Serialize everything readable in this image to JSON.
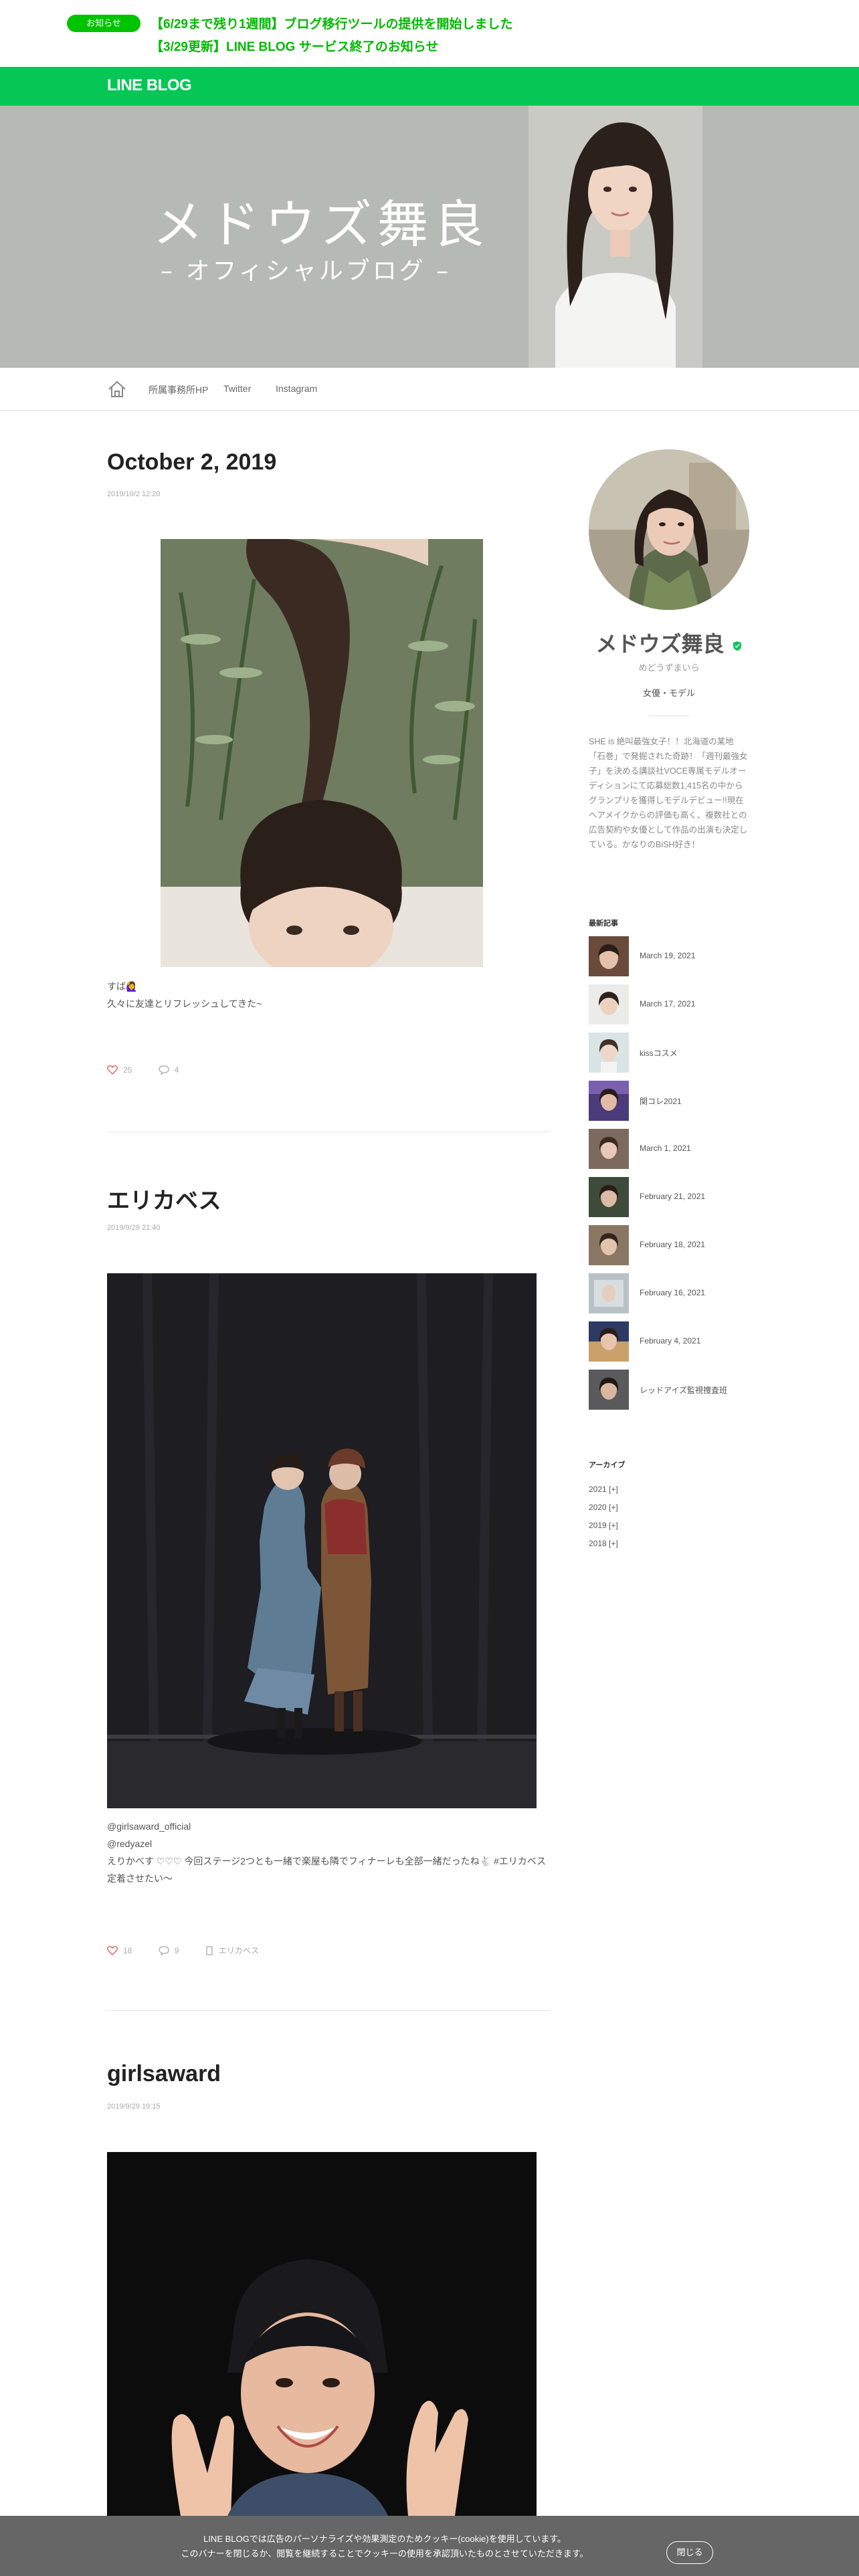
{
  "notice": {
    "badge": "お知らせ",
    "links": [
      "【6/29まで残り1週間】ブログ移行ツールの提供を開始しました",
      "【3/29更新】LINE BLOG サービス終了のお知らせ"
    ]
  },
  "header": {
    "logo": "LINE BLOG"
  },
  "hero": {
    "title": "メドウズ舞良",
    "subtitle": "– オフィシャルブログ –"
  },
  "nav": {
    "home_icon": "home-icon",
    "links": [
      "所属事務所HP",
      "Twitter",
      "Instagram"
    ]
  },
  "posts": [
    {
      "title": "October 2, 2019",
      "date": "2019/10/2 12:20",
      "lines": [
        "すば🙋‍♀️",
        "久々に友達とリフレッシュしてきた~"
      ],
      "likes": "25",
      "comments": "4"
    },
    {
      "title": "エリカベス",
      "date": "2019/9/29 21:40",
      "lines": [
        "@girlsaward_official",
        "@redyazel",
        "えりかべす ♡♡♡ 今回ステージ2つとも一緒で楽屋も隣でフィナーレも全部一緒だったね🐇 #エリカベス",
        "定着させたい〜"
      ],
      "likes": "18",
      "comments": "9",
      "tag": "エリカベス"
    },
    {
      "title": "girlsaward",
      "date": "2019/9/29 19:15"
    }
  ],
  "profile": {
    "name": "メドウズ舞良",
    "kana": "めどうずまいら",
    "role": "女優・モデル",
    "bio": "SHE is 絶叫最強女子！！北海道の某地「石巻」で発掘された奇跡！「週刊最強女子」を決める講談社VOCE専属モデルオーディションにて応募総数1,415名の中からグランプリを獲得しモデルデビュー!!現在へアメイクからの評価も高く、複数社との広告契約や女優として作品の出演も決定している。かなりのBiSH好き！",
    "verified_icon": "verified-badge-icon"
  },
  "sidebar": {
    "recent_heading": "最新記事",
    "recent": [
      "March 19, 2021",
      "March 17, 2021",
      "kissコスメ",
      "関コレ2021",
      "March 1, 2021",
      "February 21, 2021",
      "February 18, 2021",
      "February 16, 2021",
      "February 4, 2021",
      "レッドアイズ監視捜査班"
    ],
    "archive_heading": "アーカイブ",
    "archives": [
      "2021 [+]",
      "2020 [+]",
      "2019 [+]",
      "2018 [+]"
    ]
  },
  "cookie": {
    "text_line1": "LINE BLOGでは広告のパーソナライズや効果測定のためクッキー(cookie)を使用しています。",
    "text_line2": "このバナーを閉じるか、閲覧を継続することでクッキーの使用を承認頂いたものとさせていただきます。",
    "close": "閉じる"
  },
  "colors": {
    "brand": "#06c755",
    "notice_link": "#00b900",
    "hero_bg": "#b5bab6",
    "cookie_bg": "#666666"
  }
}
